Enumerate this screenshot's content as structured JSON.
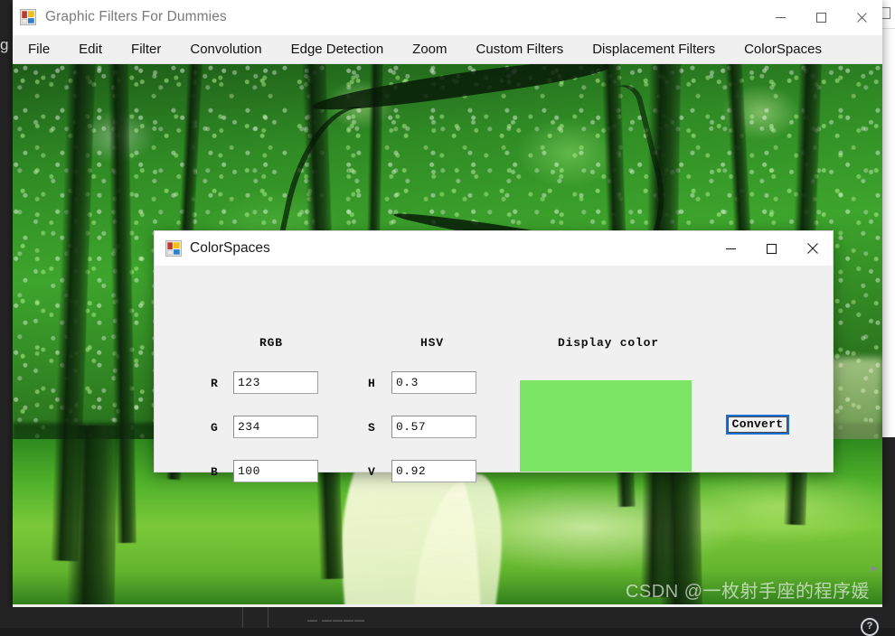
{
  "app": {
    "title": "Graphic Filters For Dummies",
    "icon": "windows-forms-icon",
    "window_controls": {
      "minimize": "—",
      "maximize": "□",
      "close": "✕"
    },
    "menu": [
      {
        "label": "File"
      },
      {
        "label": "Edit"
      },
      {
        "label": "Filter"
      },
      {
        "label": "Convolution"
      },
      {
        "label": "Edge Detection"
      },
      {
        "label": "Zoom"
      },
      {
        "label": "Custom Filters"
      },
      {
        "label": "Displacement Filters"
      },
      {
        "label": "ColorSpaces"
      }
    ],
    "canvas": {
      "image_description": "forest path photograph",
      "watermark": "CSDN @一枚射手座的程序媛"
    }
  },
  "desktop": {
    "left_edge_text": "g",
    "taskbar_text": "— ————",
    "help_badge": "?"
  },
  "dialog": {
    "title": "ColorSpaces",
    "icon": "windows-forms-icon",
    "window_controls": {
      "minimize": "—",
      "maximize": "□",
      "close": "✕"
    },
    "headers": {
      "rgb": "RGB",
      "hsv": "HSV",
      "display": "Display color"
    },
    "rgb_fields": [
      {
        "label": "R",
        "value": "123"
      },
      {
        "label": "G",
        "value": "234"
      },
      {
        "label": "B",
        "value": "100"
      }
    ],
    "hsv_fields": [
      {
        "label": "H",
        "value": "0.3"
      },
      {
        "label": "S",
        "value": "0.57"
      },
      {
        "label": "V",
        "value": "0.92"
      }
    ],
    "swatch_color": "#7ce565",
    "convert_button": "Convert",
    "accent_focus_color": "#1a6fd4"
  }
}
